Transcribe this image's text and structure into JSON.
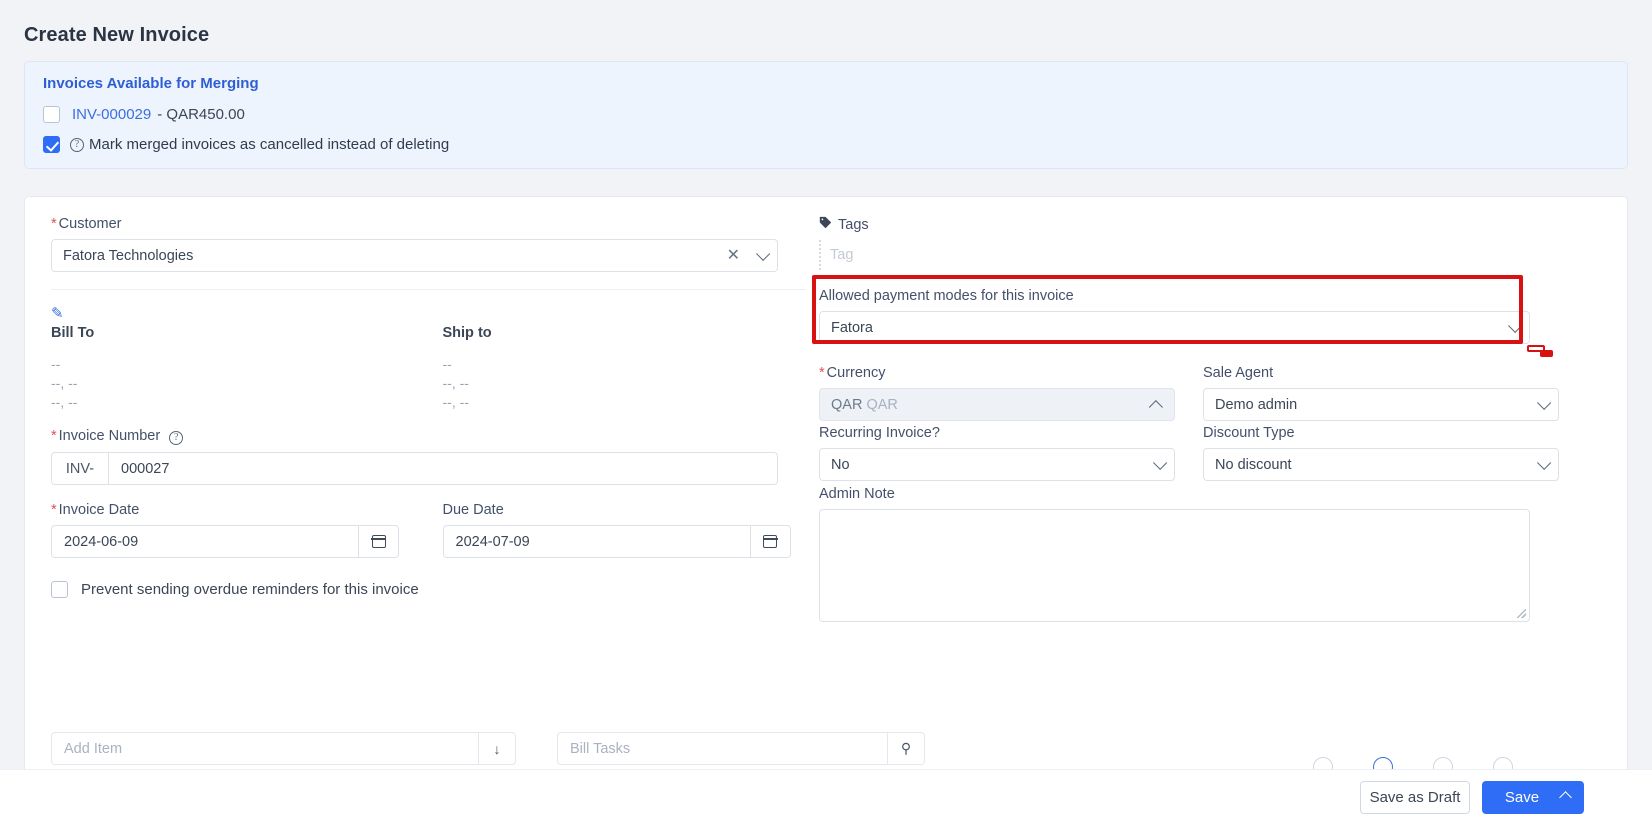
{
  "page": {
    "title": "Create New Invoice"
  },
  "merge": {
    "heading": "Invoices Available for Merging",
    "invoice_link": "INV-000029",
    "invoice_amount": "- QAR450.00",
    "cancel_option_label": "Mark merged invoices as cancelled instead of deleting",
    "invoice_checked": false,
    "cancel_checked": true
  },
  "form": {
    "customer": {
      "label": "Customer",
      "value": "Fatora Technologies",
      "required": true
    },
    "bill_to": {
      "label": "Bill To",
      "lines": [
        "--",
        "--, --",
        "--, --"
      ]
    },
    "ship_to": {
      "label": "Ship to",
      "lines": [
        "--",
        "--, --",
        "--, --"
      ]
    },
    "invoice_number": {
      "label": "Invoice Number",
      "prefix": "INV-",
      "value": "000027",
      "required": true
    },
    "invoice_date": {
      "label": "Invoice Date",
      "value": "2024-06-09",
      "required": true
    },
    "due_date": {
      "label": "Due Date",
      "value": "2024-07-09",
      "required": false
    },
    "prevent_reminders": {
      "label": "Prevent sending overdue reminders for this invoice",
      "checked": false
    },
    "tags": {
      "label": "Tags",
      "placeholder": "Tag",
      "value": ""
    },
    "payment_modes": {
      "label": "Allowed payment modes for this invoice",
      "value": "Fatora"
    },
    "currency": {
      "label": "Currency",
      "value": "QAR",
      "value_secondary": "QAR",
      "required": true
    },
    "sale_agent": {
      "label": "Sale Agent",
      "value": "Demo admin"
    },
    "recurring_invoice": {
      "label": "Recurring Invoice?",
      "value": "No"
    },
    "discount_type": {
      "label": "Discount Type",
      "value": "No discount"
    },
    "admin_note": {
      "label": "Admin Note",
      "value": ""
    }
  },
  "items_section": {
    "add_item_placeholder": "Add Item",
    "bill_tasks_placeholder": "Bill Tasks"
  },
  "footer": {
    "save_draft_label": "Save as Draft",
    "save_label": "Save"
  },
  "colors": {
    "accent": "#2f6df6",
    "link": "#3b6fe0",
    "required": "#e05252",
    "annotation": "#d81111",
    "panel_bg": "#eef4fd"
  }
}
